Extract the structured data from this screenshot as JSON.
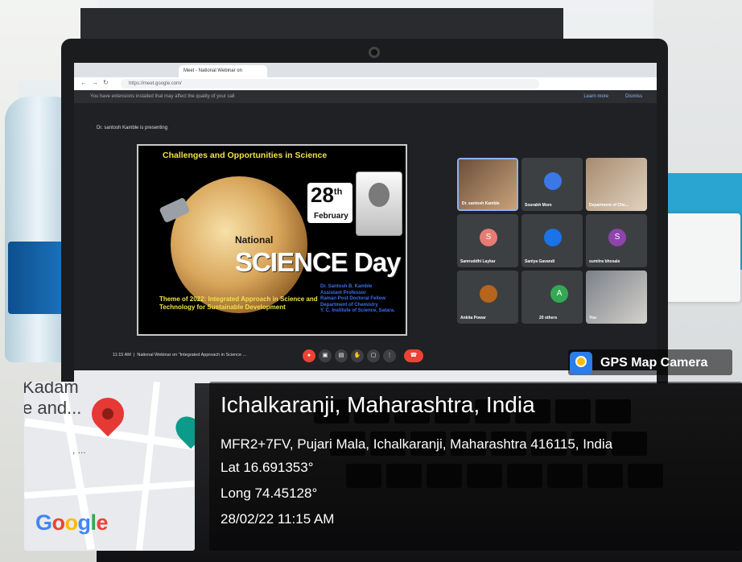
{
  "screen": {
    "browser": {
      "tabs": [
        "Meet - National Webinar on"
      ],
      "address": "https://meet.google.com/",
      "extension_notice": "You have extensions installed that may affect the quality of your call",
      "learn_more": "Learn more",
      "dismiss": "Dismiss"
    },
    "presenting_text": "Dr. santosh Kamble is presenting",
    "slide": {
      "title": "Challenges and Opportunities in Science",
      "day_number": "28",
      "day_suffix": "th",
      "month": "February",
      "national": "National",
      "science_day": "SCIENCE Day",
      "theme": "Theme of 2022: Integrated Approach in Science and Technology for Sustainable Development",
      "speaker_lines": [
        "Dr. Santosh B. Kamble",
        "Assistant Professor",
        "Raman Post Doctoral Fellow",
        "Department of Chemistry",
        "Y. C. Institute of Science, Satara."
      ]
    },
    "participants": [
      {
        "name": "Dr. santosh Kamble",
        "type": "camera",
        "speaking": true
      },
      {
        "name": "Sourabh More",
        "type": "avatar",
        "initial": "",
        "color": "#3b78e7"
      },
      {
        "name": "Department of Che...",
        "type": "camera"
      },
      {
        "name": "Samruddhi Laykar",
        "type": "avatar",
        "initial": "S",
        "color": "#e67c73"
      },
      {
        "name": "Saniya Gavandi",
        "type": "camera"
      },
      {
        "name": "sumitra bhosale",
        "type": "avatar",
        "initial": "S",
        "color": "#8e44ad"
      },
      {
        "name": "Ankita Powar",
        "type": "camera"
      },
      {
        "name": "20 others",
        "type": "others",
        "initial": "A",
        "color": "#34a853"
      },
      {
        "name": "You",
        "type": "camera"
      }
    ],
    "meeting_bar": {
      "time": "11:15 AM",
      "title": "National Webinar on \"Integrated Approach in Science ..."
    }
  },
  "gps_overlay": {
    "app_name": "GPS Map Camera",
    "map": {
      "label_line1": "Kadam",
      "label_line2": "e and...",
      "dots": ",   ...",
      "google": "Google"
    },
    "city": "Ichalkaranji, Maharashtra, India",
    "address": "MFR2+7FV, Pujari Mala, Ichalkaranji, Maharashtra 416115, India",
    "lat": "Lat 16.691353°",
    "long": "Long 74.45128°",
    "datetime": "28/02/22 11:15 AM"
  },
  "colors": {
    "slide_title": "#f1e24a",
    "speaker_text": "#3d6ee8",
    "end_call": "#ea4335",
    "map_pin": "#e53935"
  }
}
